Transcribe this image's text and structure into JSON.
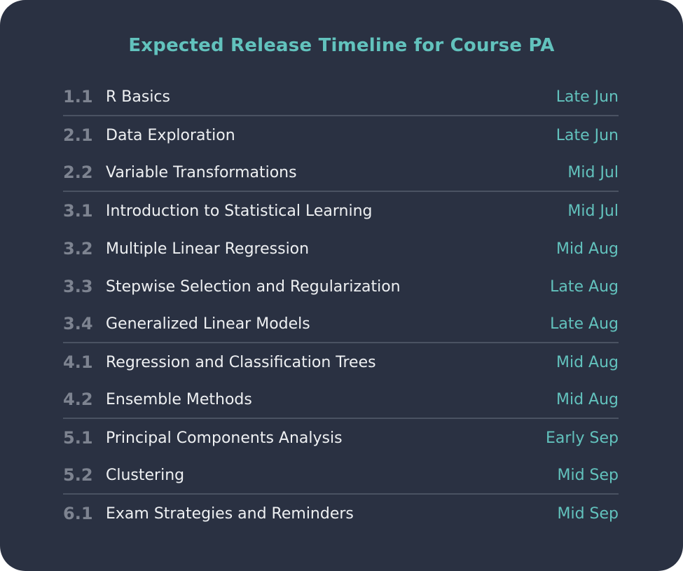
{
  "title": "Expected Release Timeline for Course PA",
  "colors": {
    "accent": "#62c2bd",
    "background": "#2a3142",
    "number": "#7d8390",
    "text": "#eef0f2",
    "divider": "#4a5262"
  },
  "rows": [
    {
      "num": "1.1",
      "name": "R Basics",
      "date": "Late Jun",
      "divider_after": true
    },
    {
      "num": "2.1",
      "name": "Data Exploration",
      "date": "Late Jun",
      "divider_after": false
    },
    {
      "num": "2.2",
      "name": "Variable Transformations",
      "date": "Mid Jul",
      "divider_after": true
    },
    {
      "num": "3.1",
      "name": "Introduction to Statistical Learning",
      "date": "Mid Jul",
      "divider_after": false
    },
    {
      "num": "3.2",
      "name": "Multiple Linear Regression",
      "date": "Mid Aug",
      "divider_after": false
    },
    {
      "num": "3.3",
      "name": "Stepwise Selection and Regularization",
      "date": "Late Aug",
      "divider_after": false
    },
    {
      "num": "3.4",
      "name": "Generalized Linear Models",
      "date": "Late Aug",
      "divider_after": true
    },
    {
      "num": "4.1",
      "name": "Regression and Classification Trees",
      "date": "Mid Aug",
      "divider_after": false
    },
    {
      "num": "4.2",
      "name": "Ensemble Methods",
      "date": "Mid Aug",
      "divider_after": true
    },
    {
      "num": "5.1",
      "name": "Principal Components Analysis",
      "date": "Early Sep",
      "divider_after": false
    },
    {
      "num": "5.2",
      "name": "Clustering",
      "date": "Mid Sep",
      "divider_after": true
    },
    {
      "num": "6.1",
      "name": "Exam Strategies and Reminders",
      "date": "Mid Sep",
      "divider_after": false
    }
  ]
}
